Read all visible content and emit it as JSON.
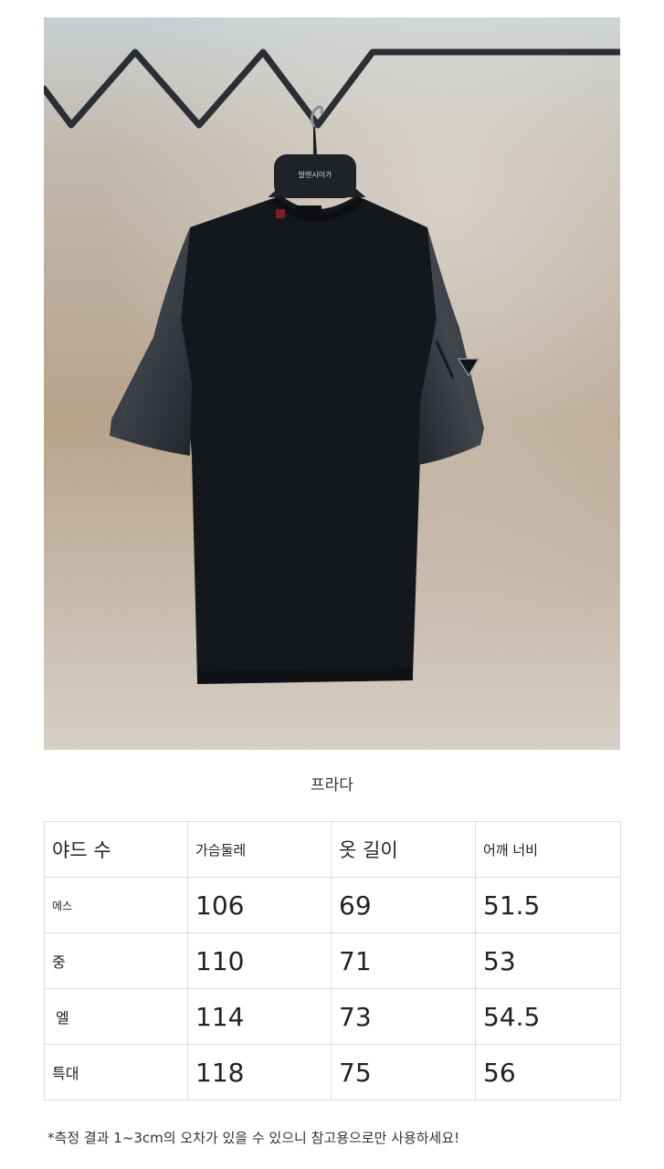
{
  "brand": "프라다",
  "hanger_label": "발렌시아가",
  "size_table": {
    "headers": [
      "야드 수",
      "가슴둘레",
      "옷 길이",
      "어깨 너비"
    ],
    "rows": [
      {
        "size": "에스",
        "chest": "106",
        "length": "69",
        "shoulder": "51.5"
      },
      {
        "size": "중",
        "chest": "110",
        "length": "71",
        "shoulder": "53"
      },
      {
        "size": "엘",
        "chest": "114",
        "length": "73",
        "shoulder": "54.5"
      },
      {
        "size": "특대",
        "chest": "118",
        "length": "75",
        "shoulder": "56"
      }
    ]
  },
  "note": "*측정 결과 1~3cm의 오차가 있을 수 있으니 참고용으로만 사용하세요!",
  "colors": {
    "shirt": "#14171c",
    "sleeve": "#2a2d33",
    "background": "#c4b7a6",
    "rack": "#2b2e33"
  }
}
